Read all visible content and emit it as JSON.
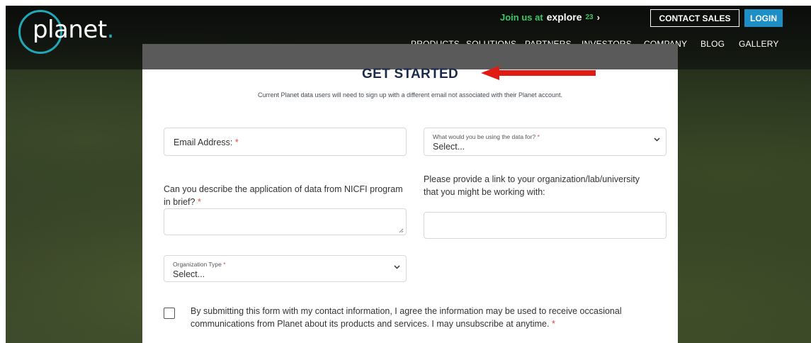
{
  "header": {
    "logo_text": "planet",
    "logo_dot": ".",
    "promo": {
      "prefix": "Join us at",
      "brand": "explore",
      "year": "23",
      "chevron": "›"
    },
    "contact_sales_label": "CONTACT SALES",
    "login_label": "LOGIN",
    "nav": [
      "PRODUCTS",
      "SOLUTIONS",
      "PARTNERS",
      "INVESTORS",
      "COMPANY",
      "BLOG",
      "GALLERY"
    ]
  },
  "form": {
    "title": "GET STARTED",
    "subtitle": "Current Planet data users will need to sign up with a different email not associated with their Planet account.",
    "required_mark": "*",
    "email_label": "Email Address:",
    "data_use": {
      "label": "What would you be using the data for?",
      "value": "Select..."
    },
    "application_label": "Can you describe the application of data from NICFI program in brief?",
    "link_label": "Please provide a link to your organization/lab/university that you might be working with:",
    "org_type": {
      "label": "Organization Type",
      "value": "Select..."
    },
    "consent_text": "By submitting this form with my contact information, I agree the information may be used to receive occasional communications from Planet about its products and services. I may unsubscribe at anytime."
  },
  "colors": {
    "accent": "#1fa8b8",
    "login_bg": "#1e8ec7",
    "promo_green": "#3ec86a",
    "required": "#e0483e",
    "annotation_arrow": "#e01b14"
  },
  "icons": [
    "chevron-right-icon",
    "chevron-down-icon",
    "resize-handle-icon",
    "red-arrow-annotation"
  ]
}
